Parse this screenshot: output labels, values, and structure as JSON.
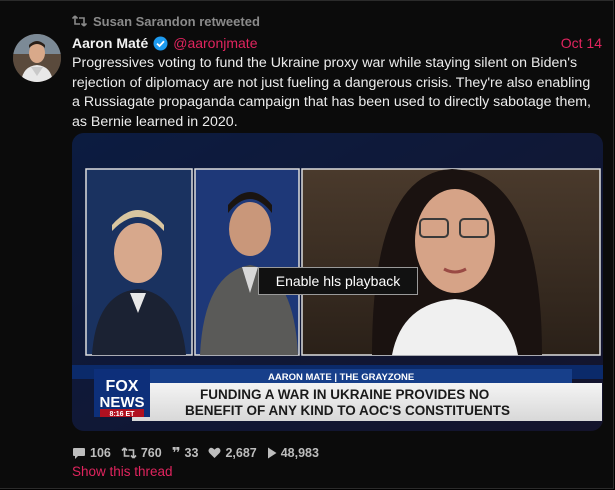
{
  "retweet": {
    "label": "Susan Sarandon retweeted"
  },
  "author": {
    "name": "Aaron Maté",
    "handle": "@aaronjmate",
    "date": "Oct 14"
  },
  "tweet": {
    "text": "Progressives voting to fund the Ukraine proxy war while staying silent on Biden's rejection of diplomacy are not just fueling a dangerous crisis. They're also enabling a Russiagate propaganda campaign that has been used to directly sabotage them, as Bernie learned in 2020."
  },
  "video": {
    "hls_button": "Enable hls playback",
    "lower_third_tag": "AARON MATE | THE GRAYZONE",
    "headline_line1": "FUNDING A WAR IN UKRAINE PROVIDES NO",
    "headline_line2": "BENEFIT OF ANY KIND TO AOC'S CONSTITUENTS",
    "network_line1": "FOX",
    "network_line2": "NEWS",
    "clock": "8:16 ET"
  },
  "stats": {
    "replies": "106",
    "retweets": "760",
    "quotes": "33",
    "likes": "2,687",
    "views": "48,983"
  },
  "thread_link": "Show this thread",
  "colors": {
    "accent": "#e0245e",
    "verified": "#1d9bf0"
  }
}
